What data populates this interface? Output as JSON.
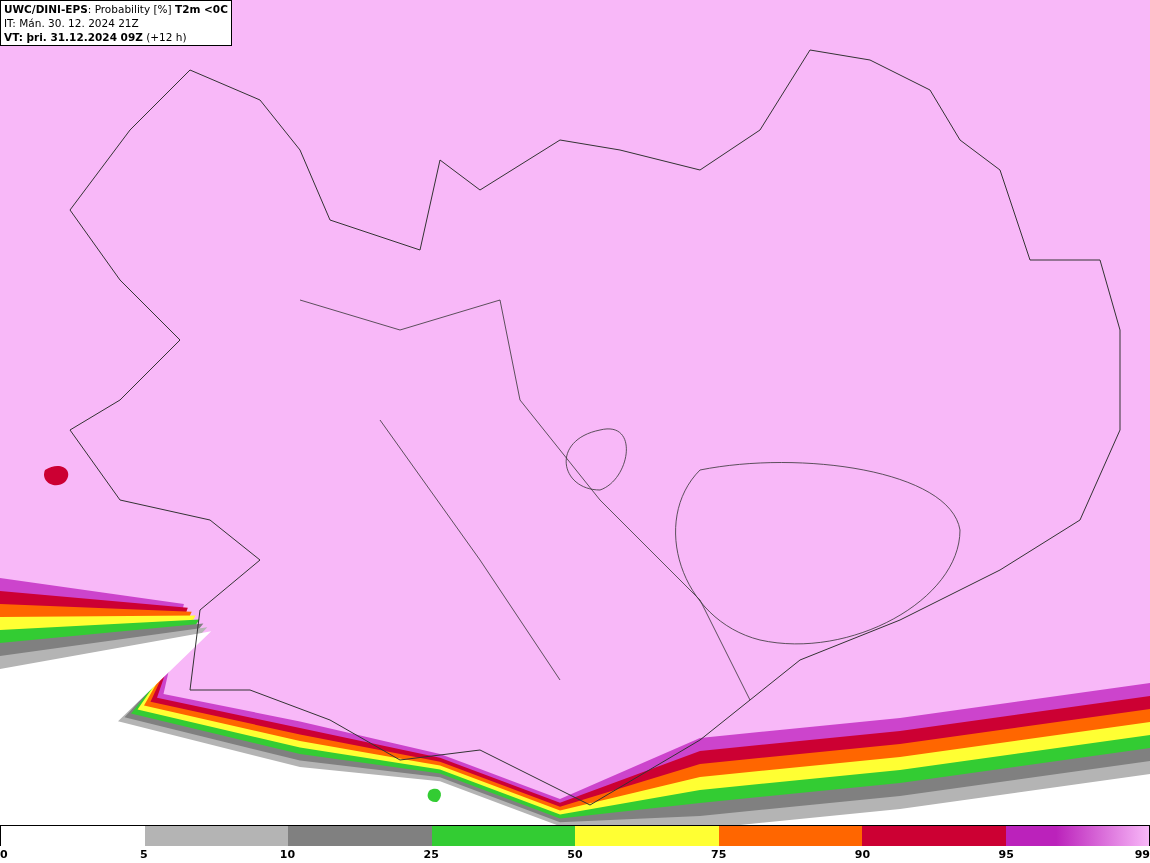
{
  "header": {
    "lines": [
      "**UWC/DINI-EPS**: Probability [%] **T2m <0C**",
      "IT: Mán. 30. 12. 2024 21Z",
      "**VT: þri. 31.12.2024 09Z** (+12 h)"
    ]
  },
  "legend": {
    "segments": [
      {
        "color": "#b4b4b4"
      },
      {
        "color": "#808080"
      },
      {
        "color": "#33cc33"
      },
      {
        "color": "#ffff33"
      },
      {
        "color": "#ff6600"
      },
      {
        "color": "#cc0033"
      },
      {
        "color": "#bb22bb"
      }
    ],
    "labels": [
      "0",
      "5",
      "10",
      "25",
      "50",
      "75",
      "90",
      "95",
      "99"
    ]
  }
}
